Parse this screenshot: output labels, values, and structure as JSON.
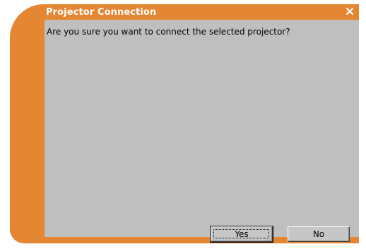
{
  "dialog": {
    "title": "Projector Connection",
    "message": "Are you sure you want to connect the selected projector?",
    "yes_label": "Yes",
    "no_label": "No"
  },
  "colors": {
    "frame": "#e58632",
    "client": "#bfbfbf",
    "title_text": "#ffffff"
  },
  "icons": {
    "close": "close-icon"
  }
}
